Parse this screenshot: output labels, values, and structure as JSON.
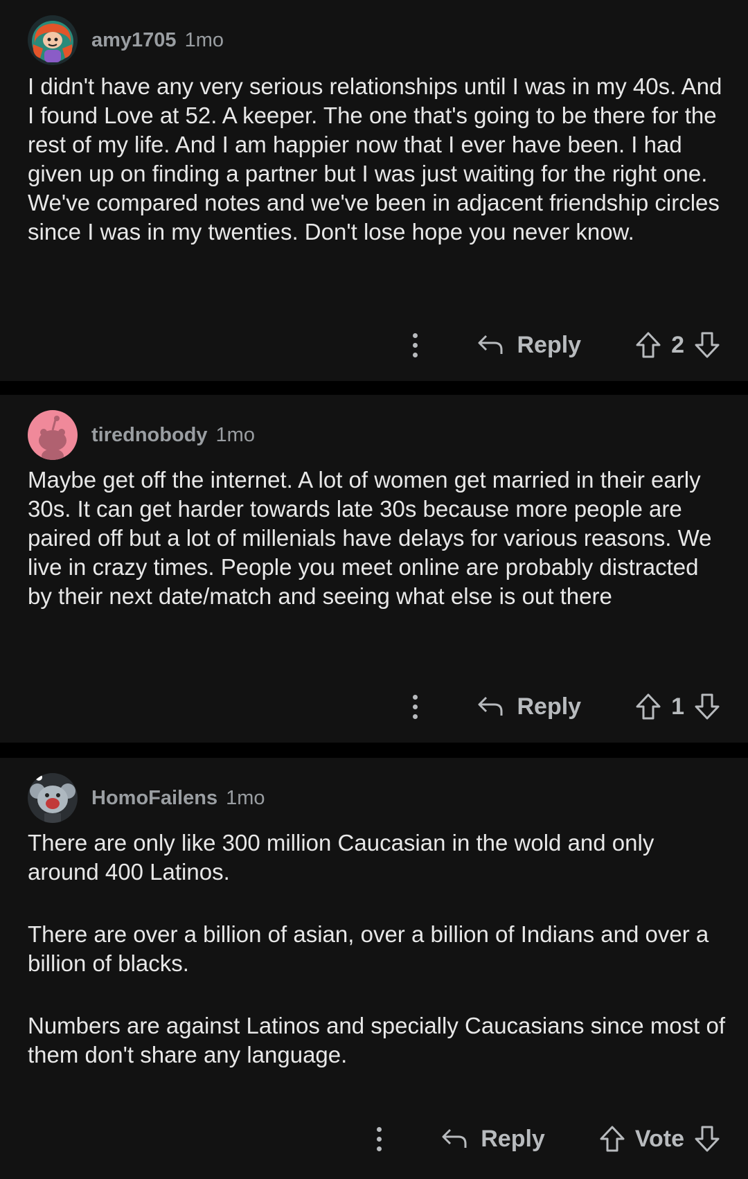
{
  "comments": [
    {
      "author": "amy1705",
      "age": "1mo",
      "avatar_icon": "snoo-avatar-red-hair-icon",
      "paragraphs": [
        "I didn't have any very serious relationships until I was in my 40s. And I found Love at 52. A keeper. The one that's going to be there for the rest of my life. And I am happier now that I ever have been. I had given up on finding a partner but I was just waiting for the right one. We've compared notes and we've been in adjacent friendship circles since I was in my twenties. Don't lose hope you never know."
      ],
      "reply_label": "Reply",
      "score": "2"
    },
    {
      "author": "tirednobody",
      "age": "1mo",
      "avatar_icon": "default-snoo-avatar-icon",
      "paragraphs": [
        "Maybe get off the internet. A lot of women get married in their early 30s. It can get harder towards late 30s because more people are paired off but a lot of millenials have delays for various reasons. We live in crazy times. People you meet online are probably distracted by their next date/match and seeing what else is out there"
      ],
      "reply_label": "Reply",
      "score": "1"
    },
    {
      "author": "HomoFailens",
      "age": "1mo",
      "avatar_icon": "koala-snoo-avatar-icon",
      "paragraphs": [
        "There are only like 300 million Caucasian in the wold and only around 400 Latinos.",
        "There are over a billion of asian, over a billion of Indians and over a billion of blacks.",
        "Numbers are against Latinos and specially Caucasians since most of them don't share any language."
      ],
      "reply_label": "Reply",
      "score": "Vote"
    }
  ],
  "colors": {
    "background": "#000000",
    "card": "#121212",
    "text": "#e8e8e8",
    "meta": "#9a9ea2",
    "action": "#b8bbbe"
  }
}
